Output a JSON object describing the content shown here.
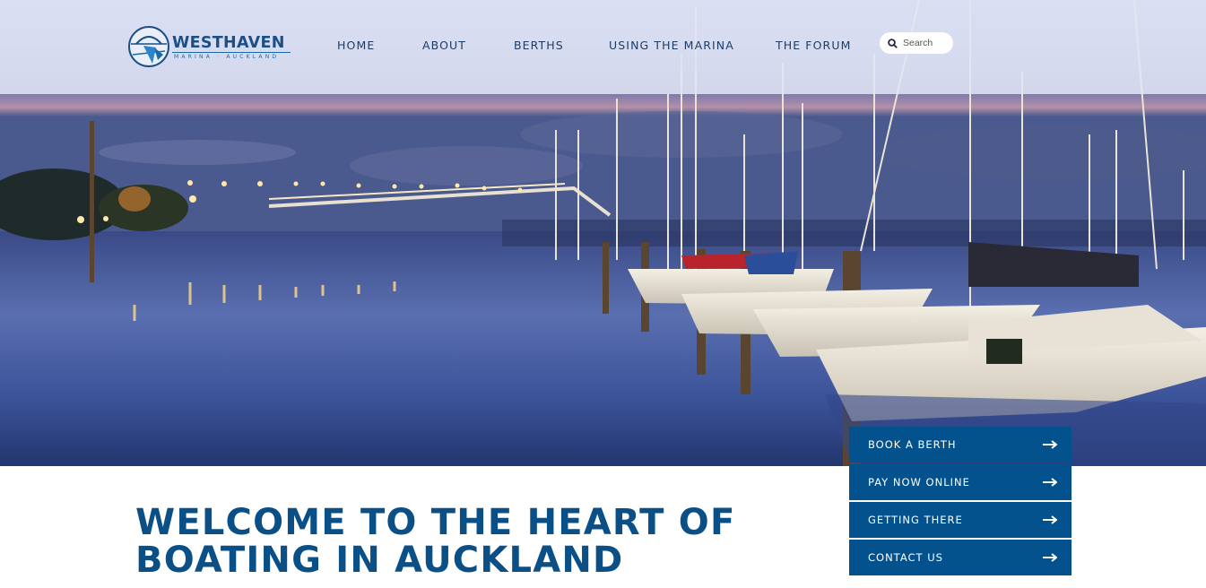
{
  "brand": {
    "name": "WESTHAVEN",
    "tagline": "MARINA · AUCKLAND",
    "logo_icon": "harbour-bridge-emblem-icon",
    "color_primary": "#03528d",
    "color_heading": "#0a4f86"
  },
  "nav": {
    "items": [
      {
        "label": "HOME"
      },
      {
        "label": "ABOUT"
      },
      {
        "label": "BERTHS"
      },
      {
        "label": "USING THE MARINA"
      },
      {
        "label": "THE FORUM"
      }
    ]
  },
  "search": {
    "placeholder": "Search",
    "icon": "search-icon"
  },
  "hero": {
    "image_description_icon": "marina-night-photo"
  },
  "cta": {
    "items": [
      {
        "label": "BOOK A BERTH",
        "icon": "arrow-right-icon"
      },
      {
        "label": "PAY NOW ONLINE",
        "icon": "arrow-right-icon"
      },
      {
        "label": "GETTING THERE",
        "icon": "arrow-right-icon"
      },
      {
        "label": "CONTACT US",
        "icon": "arrow-right-icon"
      }
    ]
  },
  "main": {
    "headline_line1": "WELCOME TO THE HEART OF",
    "headline_line2": "BOATING IN AUCKLAND"
  }
}
